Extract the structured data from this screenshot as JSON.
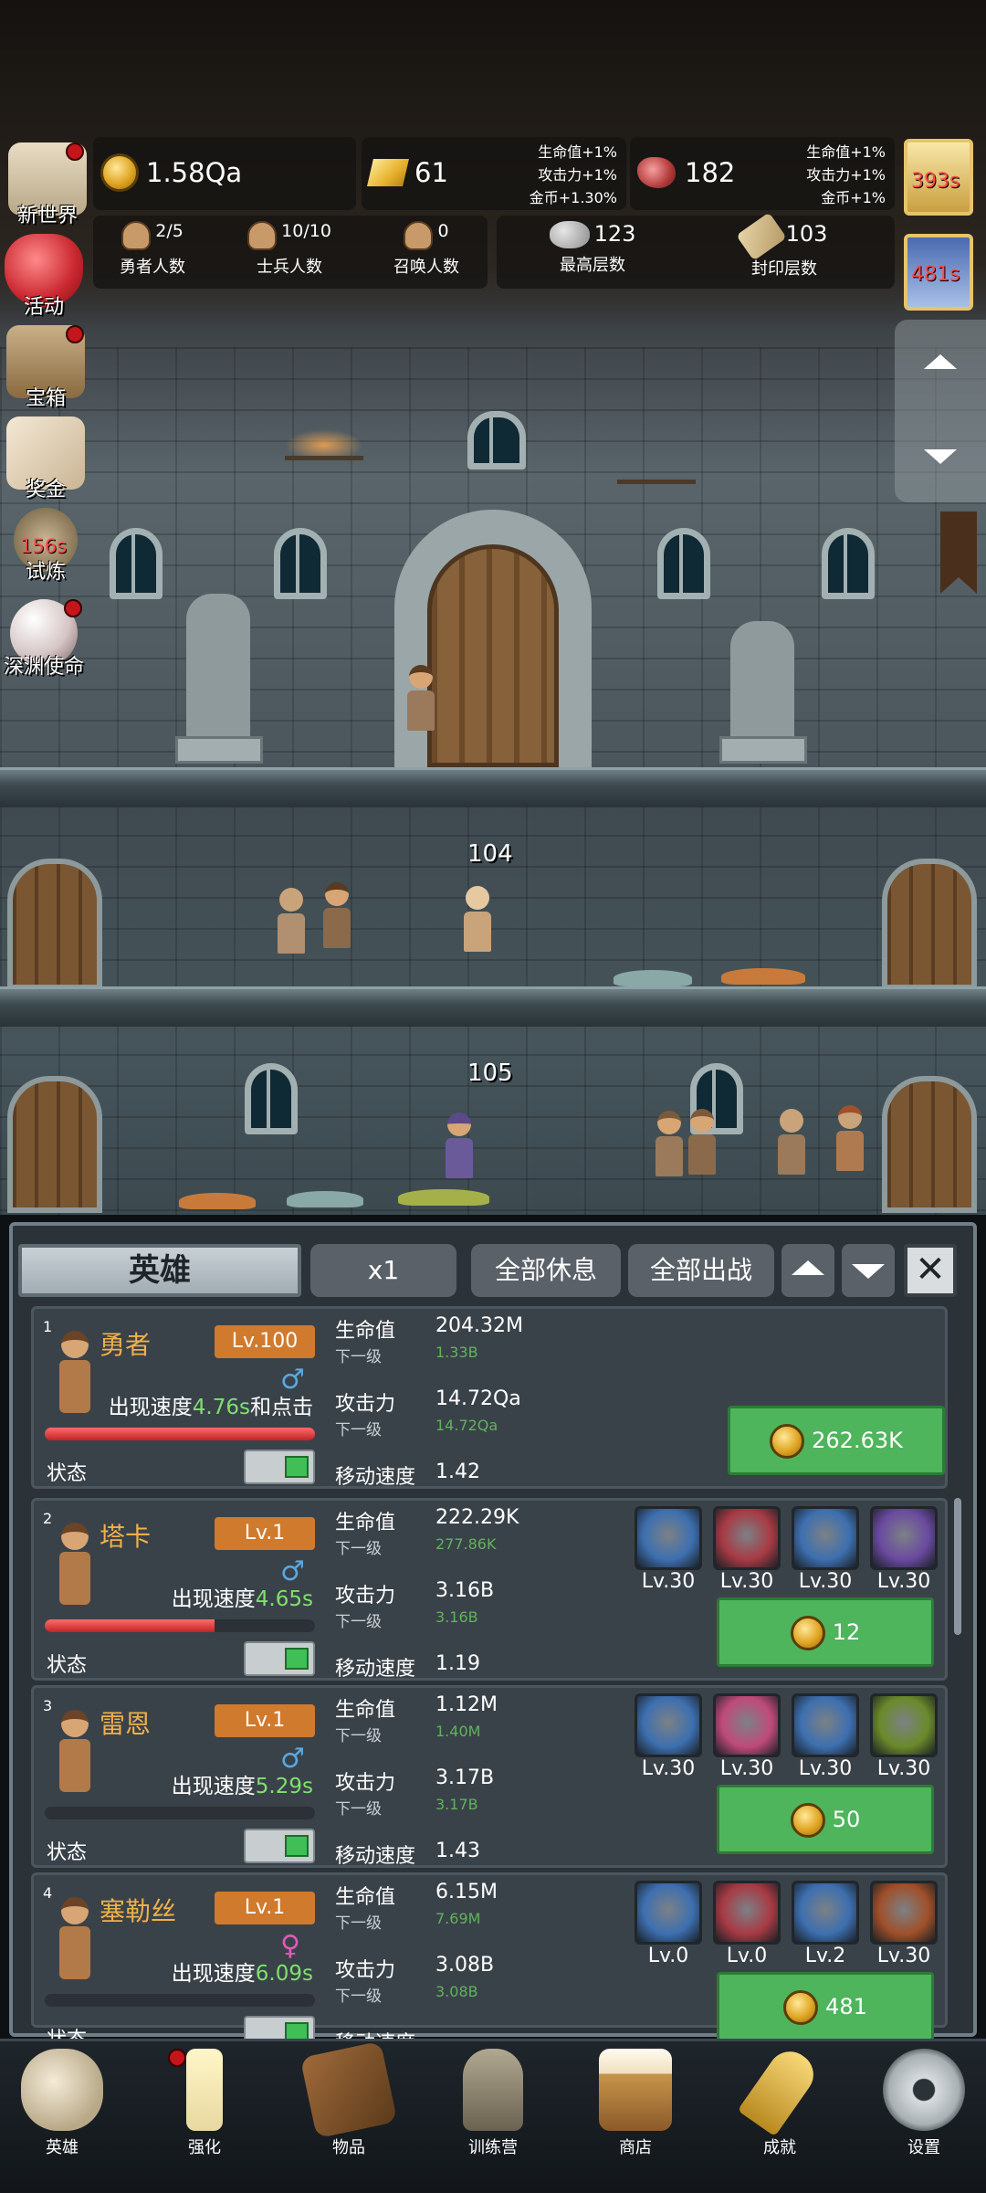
{
  "resources": {
    "coins": "1.58Qa",
    "gold_bars": "61",
    "gold_bonus": [
      "生命值+1%",
      "攻击力+1%",
      "金币+1.30%"
    ],
    "meat": "182",
    "meat_bonus": [
      "生命值+1%",
      "攻击力+1%",
      "金币+1%"
    ]
  },
  "counts": [
    {
      "value": "2/5",
      "label": "勇者人数",
      "icon": "hero-head-icon"
    },
    {
      "value": "10/10",
      "label": "士兵人数",
      "icon": "soldier-head-icon"
    },
    {
      "value": "0",
      "label": "召唤人数",
      "icon": "summon-head-icon"
    }
  ],
  "floors": {
    "highest_value": "123",
    "highest_label": "最高层数",
    "sealed_value": "103",
    "sealed_label": "封印层数"
  },
  "side_menu": [
    {
      "label": "新世界",
      "icon": "map-castle-icon",
      "dot": true
    },
    {
      "label": "活动",
      "icon": "heart-icon",
      "dot": false
    },
    {
      "label": "宝箱",
      "icon": "treasure-chest-icon",
      "dot": true
    },
    {
      "label": "奖金",
      "icon": "envelope-icon",
      "dot": false
    },
    {
      "label": "试炼",
      "icon": "trial-icon",
      "timer": "156s",
      "dot": false
    },
    {
      "label": "深渊使命",
      "icon": "pearl-icon",
      "dot": true
    }
  ],
  "right_timers": [
    "393s",
    "481s"
  ],
  "scene": {
    "floor_labels": [
      "104",
      "105"
    ]
  },
  "panel": {
    "tab_title": "英雄",
    "multiplier": "x1",
    "rest_all": "全部休息",
    "deploy_all": "全部出战"
  },
  "heroes": [
    {
      "index": "1",
      "name": "勇者",
      "level": "Lv.100",
      "gender": "♂",
      "speed_prefix": "出现速度",
      "speed": "4.76s",
      "speed_suffix": "和点击",
      "state": "状态",
      "hp_label": "生命值",
      "hp": "204.32M",
      "next_label": "下一级",
      "hp_next": "1.33B",
      "atk_label": "攻击力",
      "atk": "14.72Qa",
      "atk_next": "14.72Qa",
      "move_label": "移动速度",
      "move": "1.42",
      "upgrade_cost": "262.63K",
      "hp_fill": 1.0,
      "equips": []
    },
    {
      "index": "2",
      "name": "塔卡",
      "level": "Lv.1",
      "gender": "♂",
      "speed_prefix": "出现速度",
      "speed": "4.65s",
      "speed_suffix": "",
      "state": "状态",
      "hp_label": "生命值",
      "hp": "222.29K",
      "next_label": "下一级",
      "hp_next": "277.86K",
      "atk_label": "攻击力",
      "atk": "3.16B",
      "atk_next": "3.16B",
      "move_label": "移动速度",
      "move": "1.19",
      "upgrade_cost": "12",
      "hp_fill": 0.63,
      "equips": [
        {
          "icon": "shield-axe-icon",
          "level": "Lv.30",
          "color": "#3d6fb0"
        },
        {
          "icon": "battle-axe-icon",
          "level": "Lv.30",
          "color": "#a83a44"
        },
        {
          "icon": "boots-icon",
          "level": "Lv.30",
          "color": "#3d6fb0"
        },
        {
          "icon": "pickaxe-icon",
          "level": "Lv.30",
          "color": "#6a4aa0"
        }
      ]
    },
    {
      "index": "3",
      "name": "雷恩",
      "level": "Lv.1",
      "gender": "♂",
      "speed_prefix": "出现速度",
      "speed": "5.29s",
      "speed_suffix": "",
      "state": "状态",
      "hp_label": "生命值",
      "hp": "1.12M",
      "next_label": "下一级",
      "hp_next": "1.40M",
      "atk_label": "攻击力",
      "atk": "3.17B",
      "atk_next": "3.17B",
      "move_label": "移动速度",
      "move": "1.43",
      "upgrade_cost": "50",
      "hp_fill": 0,
      "equips": [
        {
          "icon": "sword-shield-icon",
          "level": "Lv.30",
          "color": "#3d6fb0"
        },
        {
          "icon": "sword-icon",
          "level": "Lv.30",
          "color": "#c04a7a"
        },
        {
          "icon": "boots-icon",
          "level": "Lv.30",
          "color": "#3d6fb0"
        },
        {
          "icon": "serpent-icon",
          "level": "Lv.30",
          "color": "#6a8a2a"
        }
      ]
    },
    {
      "index": "4",
      "name": "塞勒丝",
      "level": "Lv.1",
      "gender": "♀",
      "speed_prefix": "出现速度",
      "speed": "6.09s",
      "speed_suffix": "",
      "state": "状态",
      "hp_label": "生命值",
      "hp": "6.15M",
      "next_label": "下一级",
      "hp_next": "7.69M",
      "atk_label": "攻击力",
      "atk": "3.08B",
      "atk_next": "3.08B",
      "move_label": "移动速度",
      "move": "",
      "upgrade_cost": "481",
      "hp_fill": 0,
      "equips": [
        {
          "icon": "star-shield-icon",
          "level": "Lv.0",
          "color": "#3d6fb0"
        },
        {
          "icon": "fang-mouth-icon",
          "level": "Lv.0",
          "color": "#a83a44"
        },
        {
          "icon": "greaves-icon",
          "level": "Lv.2",
          "color": "#3d6fb0"
        },
        {
          "icon": "lantern-icon",
          "level": "Lv.30",
          "color": "#a0502a"
        }
      ]
    }
  ],
  "nav": [
    {
      "label": "英雄",
      "icon": "skull-icon",
      "dot": false
    },
    {
      "label": "强化",
      "icon": "candle-icon",
      "dot": true
    },
    {
      "label": "物品",
      "icon": "book-icon",
      "dot": false
    },
    {
      "label": "训练营",
      "icon": "lantern-icon",
      "dot": false
    },
    {
      "label": "商店",
      "icon": "beer-mug-icon",
      "dot": false
    },
    {
      "label": "成就",
      "icon": "key-icon",
      "dot": false
    },
    {
      "label": "设置",
      "icon": "gear-icon",
      "dot": false
    }
  ]
}
